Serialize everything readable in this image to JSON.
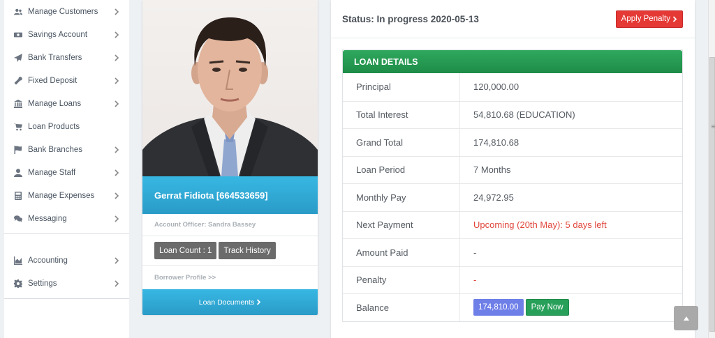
{
  "sidebar": {
    "items": [
      {
        "label": "Manage Customers",
        "icon": "users-icon",
        "has_chevron": true
      },
      {
        "label": "Savings Account",
        "icon": "money-icon",
        "has_chevron": true
      },
      {
        "label": "Bank Transfers",
        "icon": "paper-plane-icon",
        "has_chevron": true
      },
      {
        "label": "Fixed Deposit",
        "icon": "wrench-icon",
        "has_chevron": true
      },
      {
        "label": "Manage Loans",
        "icon": "bank-icon",
        "has_chevron": true
      },
      {
        "label": "Loan Products",
        "icon": "cart-icon",
        "has_chevron": false
      },
      {
        "label": "Bank Branches",
        "icon": "flag-icon",
        "has_chevron": true
      },
      {
        "label": "Manage Staff",
        "icon": "user-icon",
        "has_chevron": true
      },
      {
        "label": "Manage Expenses",
        "icon": "calculator-icon",
        "has_chevron": true
      },
      {
        "label": "Messaging",
        "icon": "comments-icon",
        "has_chevron": true
      }
    ],
    "secondary_items": [
      {
        "label": "Accounting",
        "icon": "chart-area-icon",
        "has_chevron": true
      },
      {
        "label": "Settings",
        "icon": "gear-icon",
        "has_chevron": true
      }
    ]
  },
  "profile": {
    "name": "Gerrat Fidiota [664533659]",
    "officer": "Account Officer: Sandra Bassey",
    "loan_count": "Loan Count : 1",
    "track_history": "Track History",
    "borrower_profile": "Borrower Profile >>",
    "loan_documents": "Loan Documents"
  },
  "status": {
    "text": "Status: In progress 2020-05-13",
    "penalty_button": "Apply Penalty"
  },
  "loan_details": {
    "title": "LOAN DETAILS",
    "rows": [
      {
        "key": "Principal",
        "value": "120,000.00"
      },
      {
        "key": "Total Interest",
        "value": "54,810.68 (EDUCATION)"
      },
      {
        "key": "Grand Total",
        "value": "174,810.68"
      },
      {
        "key": "Loan Period",
        "value": "7 Months"
      },
      {
        "key": "Monthly Pay",
        "value": "24,972.95"
      },
      {
        "key": "Next Payment",
        "value": "Upcoming (20th May): 5 days left"
      },
      {
        "key": "Amount Paid",
        "value": "-"
      },
      {
        "key": "Penalty",
        "value": "-"
      },
      {
        "key": "Balance",
        "value": "174,810.00"
      }
    ],
    "pay_now": "Pay Now"
  },
  "colors": {
    "accent_blue": "#2fa8d8",
    "green_header": "#23964f",
    "red": "#e53935",
    "balance_badge": "#6f7fe8"
  }
}
